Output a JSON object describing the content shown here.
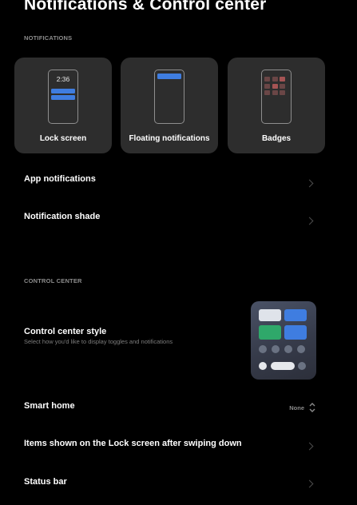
{
  "header": {
    "title": "Notifications & Control center"
  },
  "notifications_section": {
    "label": "NOTIFICATIONS",
    "cards": [
      {
        "label": "Lock screen",
        "time": "2:36"
      },
      {
        "label": "Floating notifications"
      },
      {
        "label": "Badges"
      }
    ],
    "rows": [
      {
        "label": "App notifications"
      },
      {
        "label": "Notification shade"
      }
    ]
  },
  "control_center_section": {
    "label": "CONTROL CENTER",
    "style": {
      "label": "Control center style",
      "description": "Select how you'd like to display toggles and notifications"
    },
    "smart_home": {
      "label": "Smart home",
      "value": "None"
    },
    "lock_screen_items": {
      "label": "Items shown on the Lock screen after swiping down"
    },
    "status_bar": {
      "label": "Status bar"
    }
  },
  "colors": {
    "background": "#000000",
    "card": "#2d2d2d",
    "accent_blue": "#3f7de0",
    "accent_green": "#2fa86a"
  }
}
